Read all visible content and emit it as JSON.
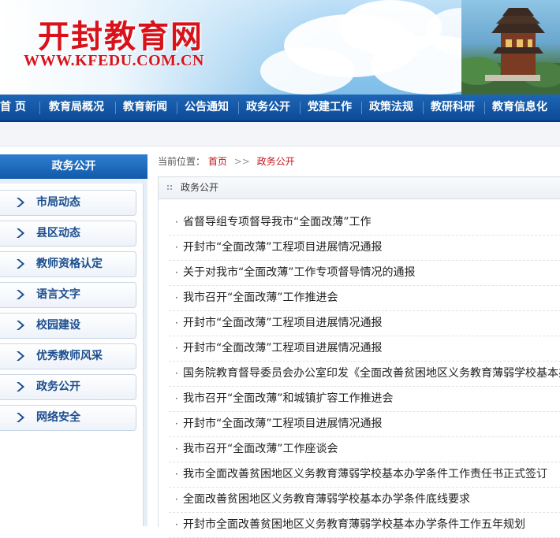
{
  "site": {
    "title_cn": "开封教育网",
    "title_en": "WWW.KFEDU.COM.CN"
  },
  "nav": {
    "items": [
      "首 页",
      "教育局概况",
      "教育新闻",
      "公告通知",
      "政务公开",
      "党建工作",
      "政策法规",
      "教研科研",
      "教育信息化"
    ]
  },
  "sidebar": {
    "title": "政务公开",
    "items": [
      "市局动态",
      "县区动态",
      "教师资格认定",
      "语言文字",
      "校园建设",
      "优秀教师风采",
      "政务公开",
      "网络安全"
    ]
  },
  "breadcrumb": {
    "label": "当前位置：",
    "home": "首页",
    "separator": ">>",
    "current": "政务公开"
  },
  "panel": {
    "title": "政务公开"
  },
  "news": [
    "省督导组专项督导我市“全面改薄”工作",
    "开封市“全面改薄”工程项目进展情况通报",
    "关于对我市“全面改薄”工作专项督导情况的通报",
    "我市召开“全面改薄”工作推进会",
    "开封市“全面改薄”工程项目进展情况通报",
    "开封市“全面改薄”工程项目进展情况通报",
    "国务院教育督导委员会办公室印发《全面改善贫困地区义务教育薄弱学校基本办学条件专项督导办法》",
    "我市召开“全面改薄”和城镇扩容工作推进会",
    "开封市“全面改薄”工程项目进展情况通报",
    "我市召开“全面改薄”工作座谈会",
    "我市全面改善贫困地区义务教育薄弱学校基本办学条件工作责任书正式签订",
    "全面改善贫困地区义务教育薄弱学校基本办学条件底线要求",
    "开封市全面改善贫困地区义务教育薄弱学校基本办学条件工作五年规划"
  ],
  "icons": {
    "sidebar_arrow": "chevron-right-icon",
    "list_bullet": "bullet-icon",
    "panel_dots": "dots-icon"
  },
  "colors": {
    "brand_red": "#d8121a",
    "nav_blue": "#0b4a97",
    "link_red": "#c1141a"
  }
}
